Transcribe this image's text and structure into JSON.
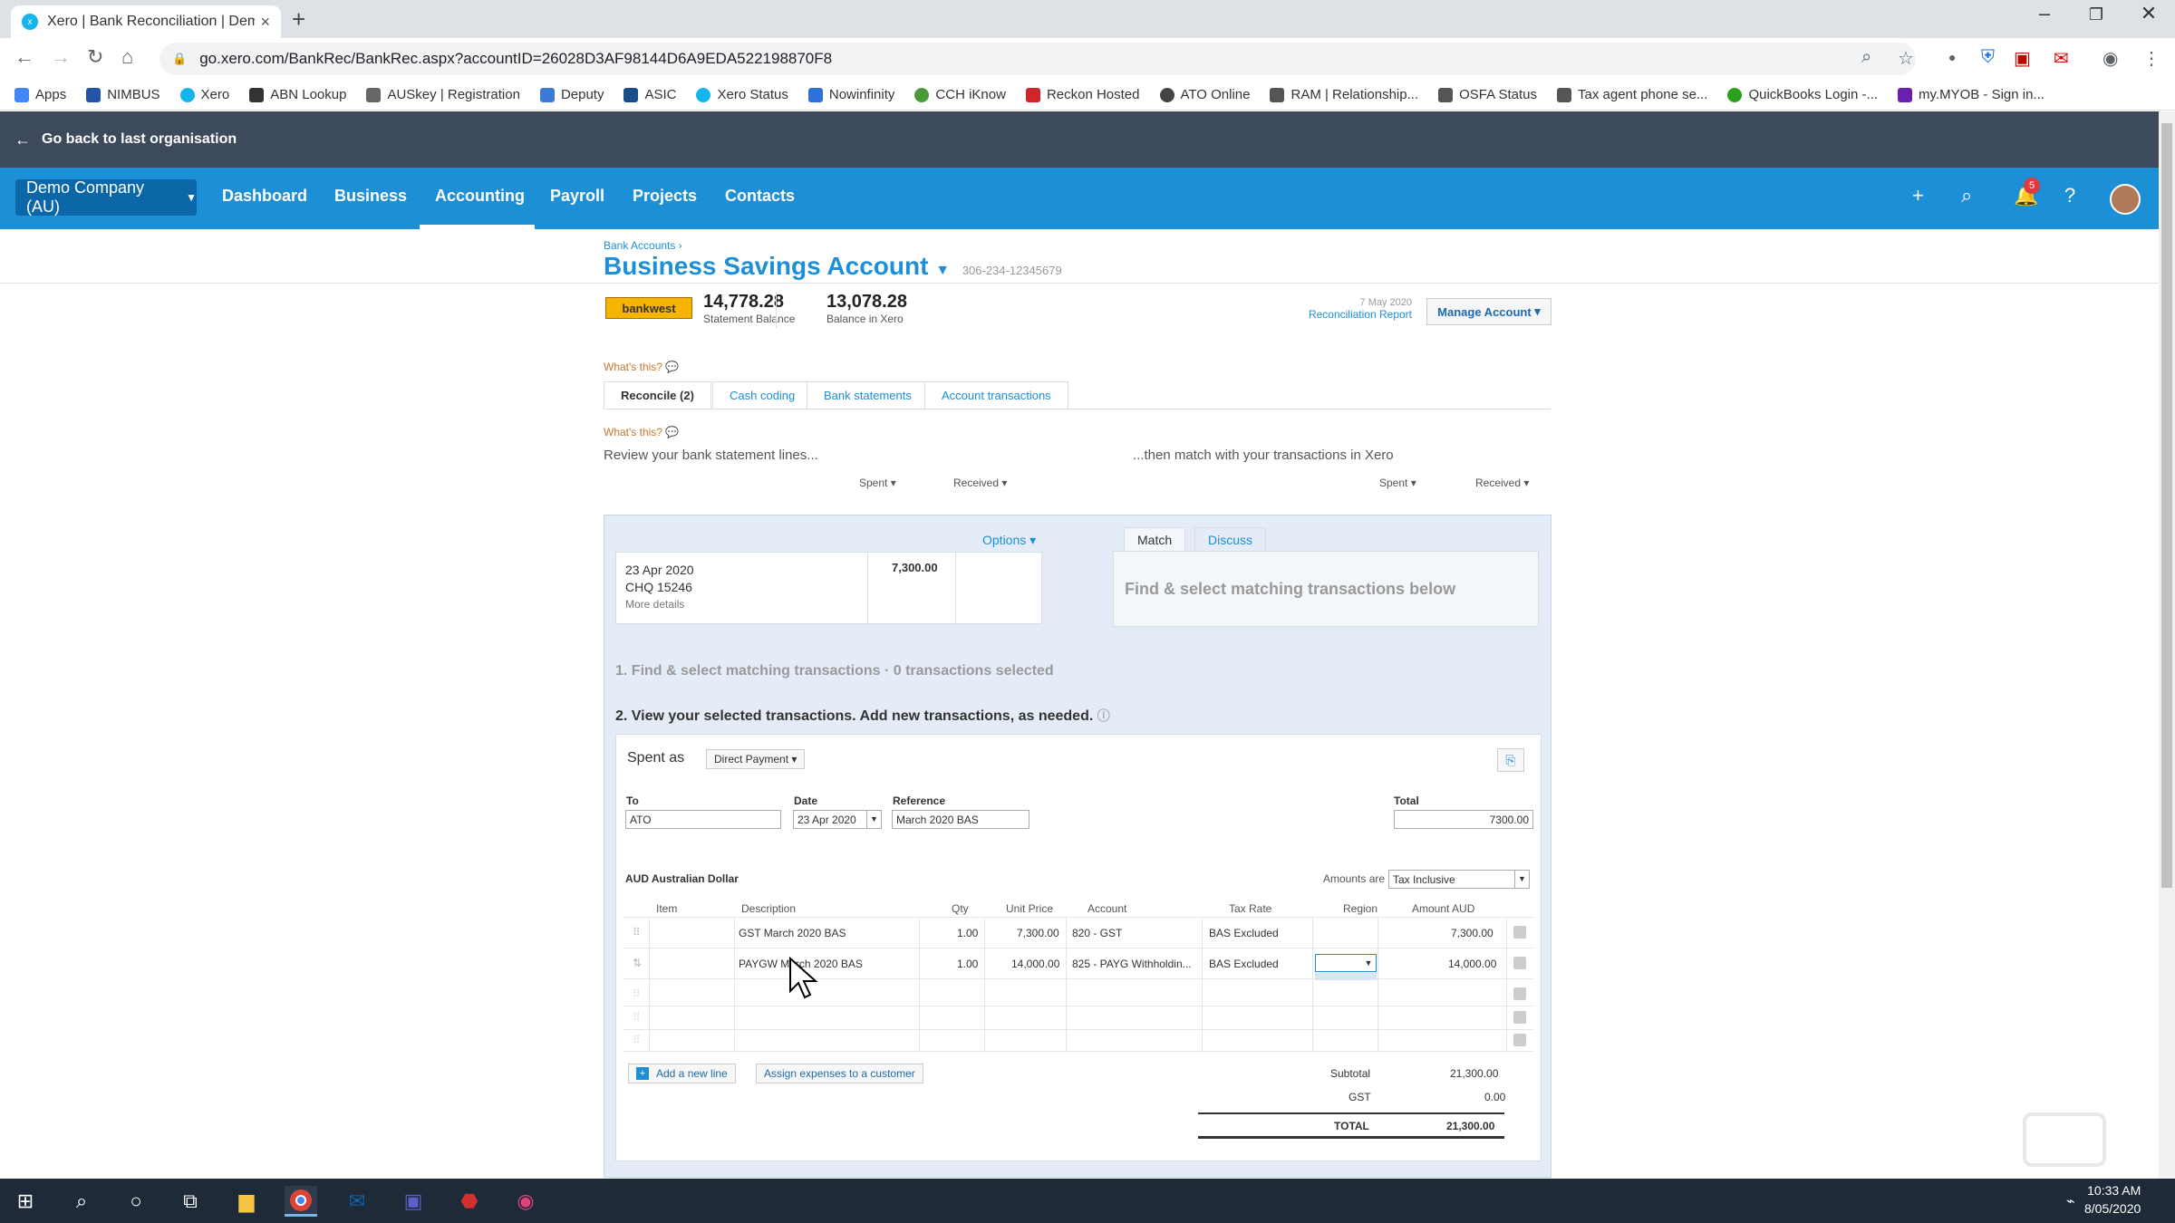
{
  "browser": {
    "tab_title": "Xero | Bank Reconciliation | Dem",
    "url": "go.xero.com/BankRec/BankRec.aspx?accountID=26028D3AF98144D6A9EDA522198870F8",
    "bookmarks": [
      "Apps",
      "NIMBUS",
      "Xero",
      "ABN Lookup",
      "AUSkey | Registration",
      "Deputy",
      "ASIC",
      "Xero Status",
      "Nowinfinity",
      "CCH iKnow",
      "Reckon Hosted",
      "ATO Online",
      "RAM | Relationship...",
      "OSFA Status",
      "Tax agent phone se...",
      "QuickBooks Login -...",
      "my.MYOB - Sign in..."
    ]
  },
  "xero": {
    "back_link": "Go back to last organisation",
    "org_name": "Demo Company (AU)",
    "nav": [
      "Dashboard",
      "Business",
      "Accounting",
      "Payroll",
      "Projects",
      "Contacts"
    ],
    "notification_count": "5",
    "breadcrumb": "Bank Accounts ›",
    "account_title": "Business Savings Account",
    "account_number": "306-234-12345679",
    "bank_name": "bankwest",
    "statement_balance": "14,778.28",
    "statement_balance_label": "Statement Balance",
    "xero_balance": "13,078.28",
    "xero_balance_label": "Balance in Xero",
    "recon_date": "7 May 2020",
    "recon_report": "Reconciliation Report",
    "manage_account": "Manage Account",
    "whats_this": "What's this?",
    "tabs": [
      "Reconcile (2)",
      "Cash coding",
      "Bank statements",
      "Account transactions"
    ],
    "review_text": "Review your bank statement lines...",
    "match_text": "...then match with your transactions in Xero",
    "spent": "Spent",
    "received": "Received"
  },
  "statement_line": {
    "date": "23 Apr 2020",
    "ref": "CHQ 15246",
    "more": "More details",
    "amount": "7,300.00",
    "options": "Options"
  },
  "match_panel": {
    "tab_match": "Match",
    "tab_discuss": "Discuss",
    "placeholder": "Find & select matching transactions below",
    "step1": "1. Find & select matching transactions · 0 transactions selected",
    "step2": "2. View your selected transactions. Add new transactions, as needed."
  },
  "form": {
    "spent_as_label": "Spent as",
    "spent_as_value": "Direct Payment",
    "to_label": "To",
    "to_value": "ATO",
    "date_label": "Date",
    "date_value": "23 Apr 2020",
    "reference_label": "Reference",
    "reference_value": "March 2020 BAS",
    "total_label": "Total",
    "total_value": "7300.00",
    "currency": "AUD Australian Dollar",
    "amounts_are_label": "Amounts are",
    "amounts_are_value": "Tax Inclusive",
    "columns": [
      "Item",
      "Description",
      "Qty",
      "Unit Price",
      "Account",
      "Tax Rate",
      "Region",
      "Amount AUD"
    ],
    "rows": [
      {
        "item": "",
        "description": "GST March 2020 BAS",
        "qty": "1.00",
        "unit_price": "7,300.00",
        "account": "820 - GST",
        "tax_rate": "BAS Excluded",
        "region": "",
        "amount": "7,300.00"
      },
      {
        "item": "",
        "description": "PAYGW March 2020 BAS",
        "qty": "1.00",
        "unit_price": "14,000.00",
        "account": "825 - PAYG Withholdin...",
        "tax_rate": "BAS Excluded",
        "region": "",
        "amount": "14,000.00"
      }
    ],
    "add_line": "Add a new line",
    "assign_expenses": "Assign expenses to a customer",
    "subtotal_label": "Subtotal",
    "subtotal_value": "21,300.00",
    "gst_label": "GST",
    "gst_value": "0.00",
    "total_row_label": "TOTAL",
    "total_row_value": "21,300.00"
  },
  "taskbar": {
    "time": "10:33 AM",
    "date": "8/05/2020"
  }
}
